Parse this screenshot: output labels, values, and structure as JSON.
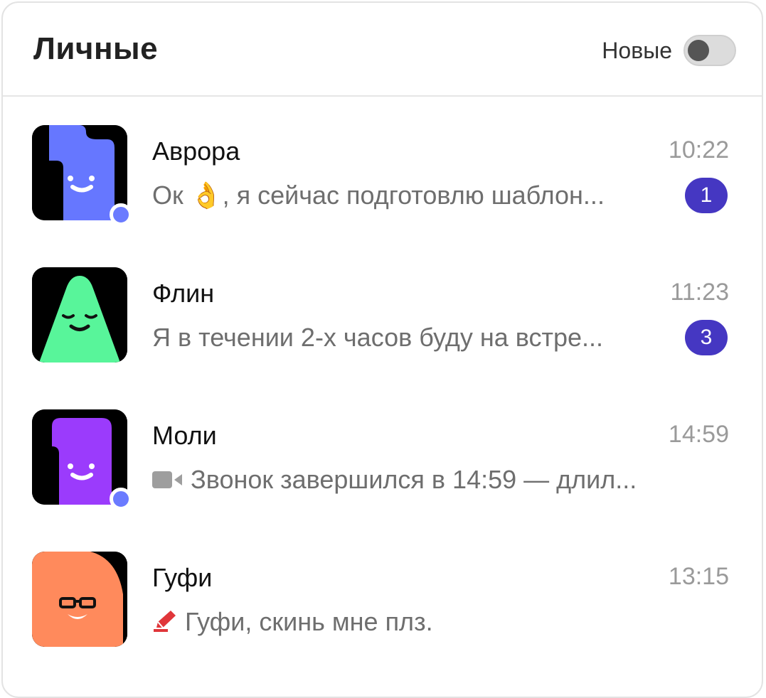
{
  "header": {
    "title": "Личные",
    "filter_label": "Новые",
    "toggle_on": false
  },
  "chats": [
    {
      "name": "Аврора",
      "time": "10:22",
      "preview_prefix": "Ок ",
      "preview_emoji": "👌",
      "preview": ", я сейчас подготовлю шаблон...",
      "unread": "1",
      "online": true,
      "avatar_icon": "aurora-avatar-icon",
      "avatar_color": "#6677ff"
    },
    {
      "name": "Флин",
      "time": "11:23",
      "preview": "Я в течении 2-х часов буду на встре...",
      "unread": "3",
      "online": false,
      "avatar_icon": "flin-avatar-icon",
      "avatar_color": "#58f59a"
    },
    {
      "name": "Моли",
      "time": "14:59",
      "preview": "Звонок завершился в 14:59 — длил...",
      "preview_icon": "video-camera-icon",
      "online": true,
      "avatar_icon": "moli-avatar-icon",
      "avatar_color": "#9b3bfc"
    },
    {
      "name": "Гуфи",
      "time": "13:15",
      "preview": "Гуфи, скинь мне плз.",
      "preview_icon": "pencil-draft-icon",
      "online": false,
      "avatar_icon": "goofy-avatar-icon",
      "avatar_color": "#ff8a5c"
    }
  ],
  "colors": {
    "accent_badge": "#4537c2",
    "online_dot": "#6b7bff",
    "draft_icon": "#e0363a"
  }
}
